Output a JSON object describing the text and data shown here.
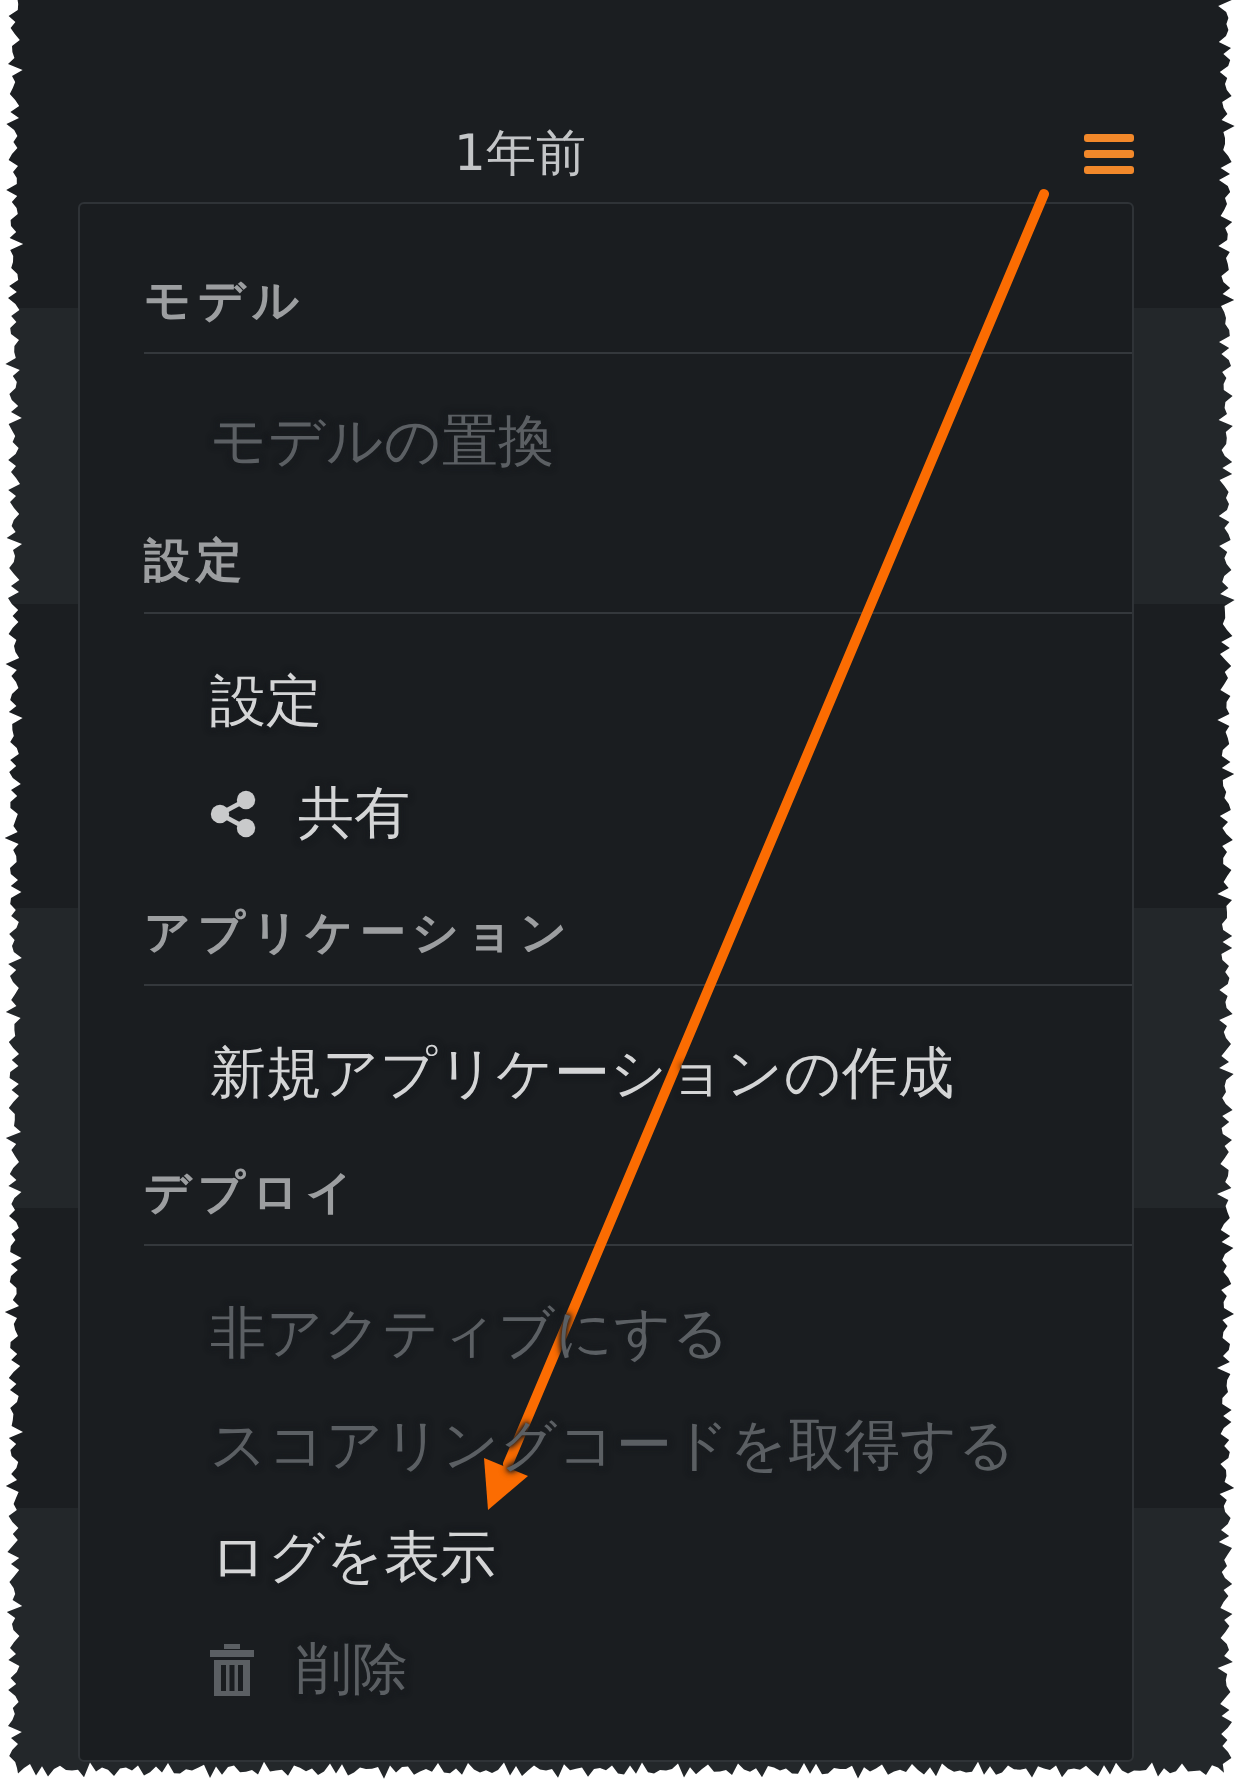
{
  "header": {
    "time_ago": "1年前"
  },
  "menu": {
    "expanded": true,
    "sections": [
      {
        "title": "モデル",
        "items": [
          {
            "kind": "plain",
            "label": "モデルの置換",
            "disabled": true
          }
        ]
      },
      {
        "title": "設定",
        "items": [
          {
            "kind": "plain",
            "label": "設定",
            "disabled": false
          },
          {
            "kind": "share",
            "label": "共有",
            "disabled": false
          }
        ]
      },
      {
        "title": "アプリケーション",
        "items": [
          {
            "kind": "plain",
            "label": "新規アプリケーションの作成",
            "disabled": false
          }
        ]
      },
      {
        "title": "デプロイ",
        "items": [
          {
            "kind": "plain",
            "label": "非アクティブにする",
            "disabled": true
          },
          {
            "kind": "plain",
            "label": "スコアリングコードを取得する",
            "disabled": true
          },
          {
            "kind": "plain",
            "label": "ログを表示",
            "disabled": false
          },
          {
            "kind": "delete",
            "label": "削除",
            "disabled": true
          }
        ]
      }
    ]
  }
}
